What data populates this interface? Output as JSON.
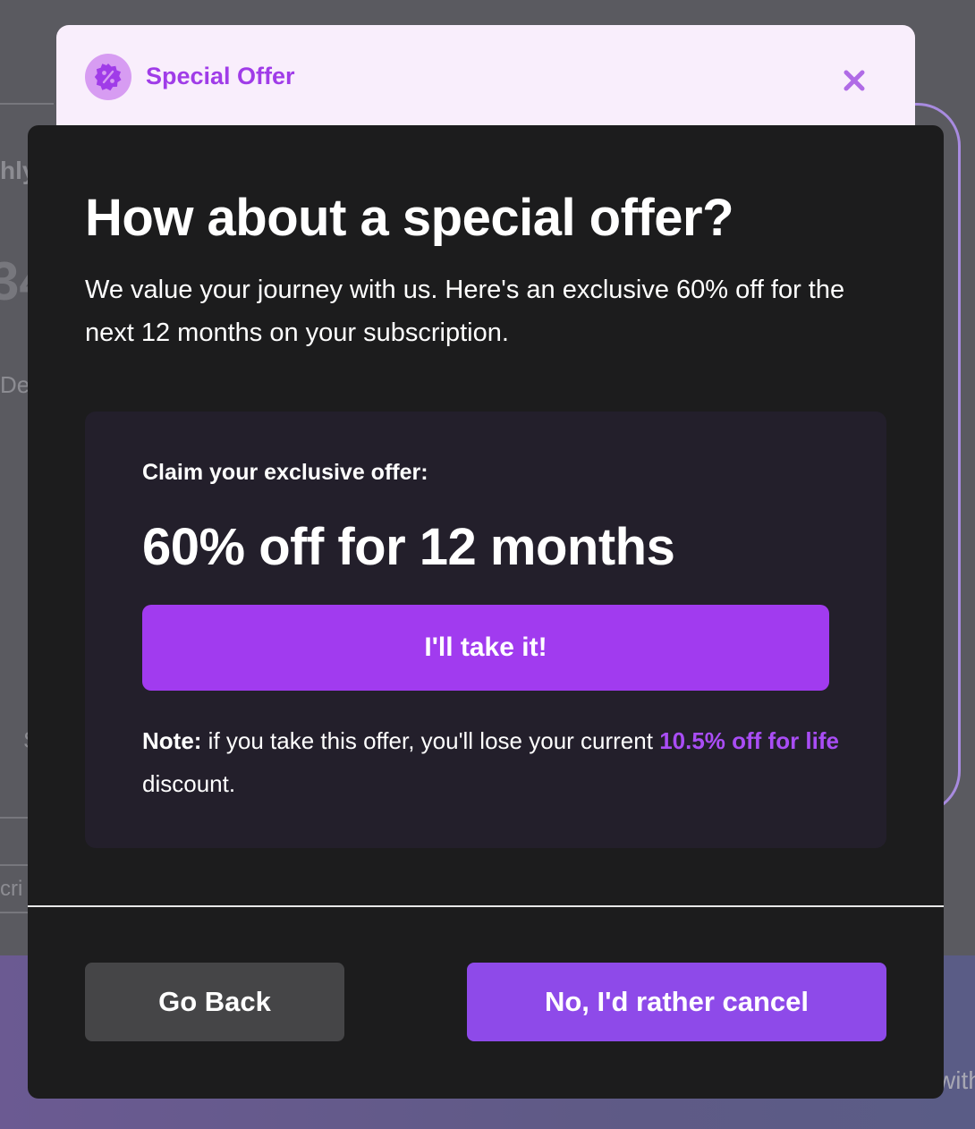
{
  "background": {
    "fragment_top": "hly",
    "fragment_price": "34",
    "fragment_desc": "De",
    "fragment_s": "S",
    "fragment_scri": "cri",
    "fragment_with": "with"
  },
  "header": {
    "badge_icon": "percent-badge-icon",
    "title": "Special Offer",
    "close_icon": "close-icon"
  },
  "modal": {
    "heading": "How about a special offer?",
    "description": "We value your journey with us. Here's an exclusive 60% off for the next 12 months on your subscription.",
    "offer_box": {
      "claim_label": "Claim your exclusive offer:",
      "amount": "60% off for 12 months",
      "accept_label": "I'll take it!",
      "note_prefix": "Note:",
      "note_text": " if you take this offer, you'll lose your current ",
      "note_highlight": "10.5% off for life",
      "note_suffix": " discount."
    },
    "back_label": "Go Back",
    "cancel_label": "No, I'd rather cancel"
  },
  "colors": {
    "accent": "#a13bef",
    "cancel": "#8e4ae9",
    "header_bg": "#f9eefc",
    "modal_bg": "#1c1c1d",
    "offer_box_bg": "#231f2b"
  }
}
